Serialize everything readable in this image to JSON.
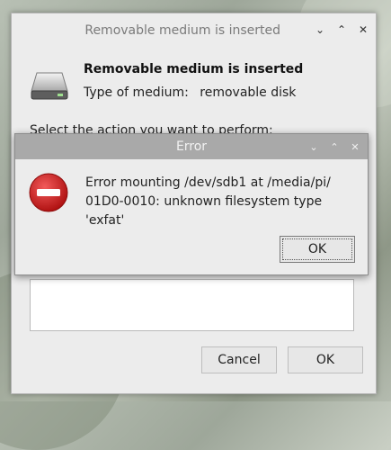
{
  "main_window": {
    "title": "Removable medium is inserted",
    "heading": "Removable medium is inserted",
    "medium_label": "Type of medium:",
    "medium_value": "removable disk",
    "action_prompt": "Select the action you want to perform:",
    "buttons": {
      "cancel": "Cancel",
      "ok": "OK"
    }
  },
  "error_dialog": {
    "title": "Error",
    "message_line1": "Error mounting /dev/sdb1 at /media/pi/",
    "message_line2": "01D0-0010: unknown filesystem type 'exfat'",
    "ok": "OK"
  },
  "window_controls": {
    "minimize": "⌄",
    "maximize": "⌃",
    "close": "✕"
  },
  "colors": {
    "error_red": "#d42121",
    "dialog_titlebar": "#a9a9a9",
    "window_bg": "#ececec"
  },
  "icons": [
    "drive-icon",
    "error-icon",
    "minimize-icon",
    "maximize-icon",
    "close-icon"
  ]
}
